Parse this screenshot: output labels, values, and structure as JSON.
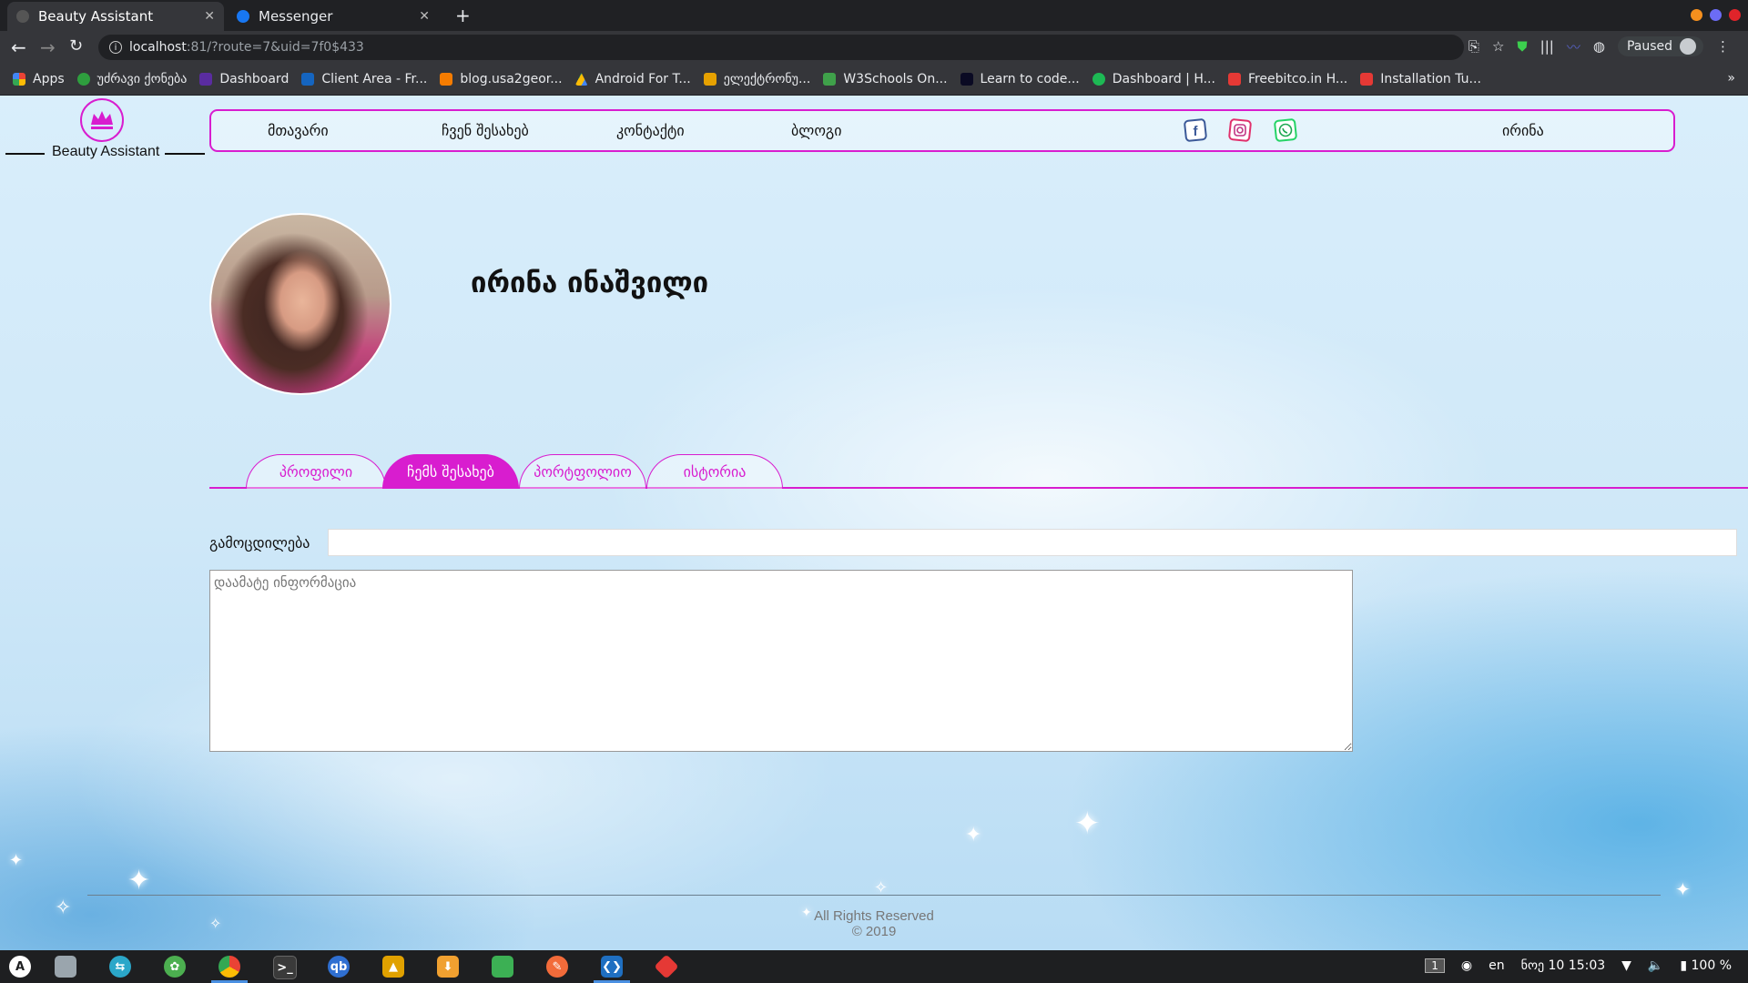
{
  "browser": {
    "tabs": [
      {
        "title": "Beauty Assistant",
        "active": true,
        "icon": "page-icon"
      },
      {
        "title": "Messenger",
        "active": false,
        "icon": "messenger-icon"
      }
    ],
    "url_host": "localhost",
    "url_path": ":81/?route=7&uid=7f0$433",
    "profile_status": "Paused",
    "bookmarks": [
      {
        "label": "Apps",
        "color": "#4285f4"
      },
      {
        "label": "უძრავი ქონება",
        "color": "#2e9e3e"
      },
      {
        "label": "Dashboard",
        "color": "#5a2ca0"
      },
      {
        "label": "Client Area - Fr...",
        "color": "#1565c0"
      },
      {
        "label": "blog.usa2geor...",
        "color": "#f57c00"
      },
      {
        "label": "Android For T...",
        "color": "#1a73e8"
      },
      {
        "label": "ელექტრონუ...",
        "color": "#e6a100"
      },
      {
        "label": "W3Schools On...",
        "color": "#3fa14a"
      },
      {
        "label": "Learn to code...",
        "color": "#0a0a23"
      },
      {
        "label": "Dashboard | H...",
        "color": "#1db954"
      },
      {
        "label": "Freebitco.in H...",
        "color": "#e53935"
      },
      {
        "label": "Installation Tu...",
        "color": "#e53935"
      }
    ]
  },
  "site": {
    "logo_text": "Beauty Assistant",
    "nav": {
      "home": "მთავარი",
      "about": "ჩვენ შესახებ",
      "contact": "კონტაქტი",
      "blog": "ბლოგი",
      "user": "ირინა"
    }
  },
  "profile": {
    "name": "ირინა ინაშვილი",
    "tabs": [
      "პროფილი",
      "ჩემს შესახებ",
      "პორტფოლიო",
      "ისტორია"
    ],
    "active_tab": 1,
    "experience_label": "გამოცდილება",
    "experience_value": "",
    "info_placeholder": "დაამატე ინფორმაცია"
  },
  "footer": {
    "rights": "All Rights Reserved",
    "year": "© 2019"
  },
  "taskbar": {
    "workspace": "1",
    "lang": "en",
    "datetime": "ნოე 10  15:03",
    "battery": "100 %"
  },
  "colors": {
    "accent": "#d81dcf",
    "browser_dark": "#202124"
  }
}
